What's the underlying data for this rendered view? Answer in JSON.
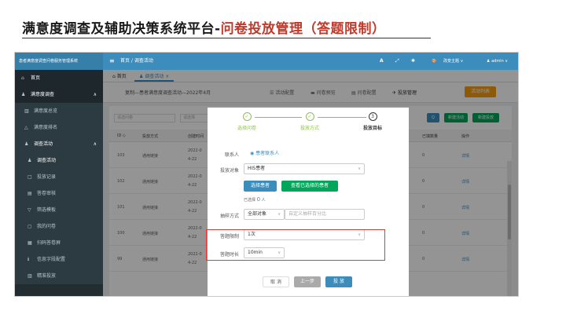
{
  "slide": {
    "title_main": "满意度调查及辅助决策系统平台-",
    "title_highlight": "问卷投放管理（答题限制）"
  },
  "topbar": {
    "brand": "患者满意度调查问卷服务管理系统",
    "menu_icon": "≡",
    "breadcrumb": "首页 / 调查活动",
    "icons": [
      "A",
      "⤢",
      "✱",
      "🎨"
    ],
    "theme_label": "改变主题 ∨",
    "user_label": "admin ∨"
  },
  "sidebar": {
    "items": [
      {
        "icon": "home-icon",
        "glyph": "⌂",
        "label": "首页",
        "level": 0
      },
      {
        "icon": "users-icon",
        "glyph": "♟",
        "label": "满意度调查",
        "level": 0,
        "caret": "∧"
      },
      {
        "icon": "chart-icon",
        "glyph": "▥",
        "label": "满意度总览",
        "level": 1
      },
      {
        "icon": "trend-icon",
        "glyph": "△",
        "label": "满意度排名",
        "level": 1
      },
      {
        "icon": "users-icon",
        "glyph": "♟",
        "label": "调查活动",
        "level": 1,
        "caret": "∧"
      },
      {
        "icon": "users-icon",
        "glyph": "♟",
        "label": "调查活动",
        "level": 2,
        "active": true
      },
      {
        "icon": "record-icon",
        "glyph": "□",
        "label": "投放记录",
        "level": 2
      },
      {
        "icon": "print-icon",
        "glyph": "▤",
        "label": "答卷审核",
        "level": 2
      },
      {
        "icon": "filter-icon",
        "glyph": "▽",
        "label": "筛选模板",
        "level": 2
      },
      {
        "icon": "doc-icon",
        "glyph": "▢",
        "label": "我的问卷",
        "level": 2
      },
      {
        "icon": "grid-icon",
        "glyph": "▦",
        "label": "扫码答卷屏",
        "level": 2
      },
      {
        "icon": "info-icon",
        "glyph": "ℹ",
        "label": "信息字段配置",
        "level": 2
      },
      {
        "icon": "chart-icon",
        "glyph": "▥",
        "label": "精准投放",
        "level": 2
      }
    ]
  },
  "tabs": [
    {
      "label": "首页",
      "active": false
    },
    {
      "label": "调查活动 ×",
      "active": true
    }
  ],
  "steprow": {
    "title": "复制—患者满意度调查活动—2022年4月",
    "steps": [
      "活动配置",
      "问卷预览",
      "问卷配置",
      "投放管理"
    ],
    "action_button": "活动列表"
  },
  "bg_table": {
    "filters": [
      "请选问卷",
      "请选择"
    ],
    "buttons": [
      "Q",
      "新建活动",
      "新建投放"
    ],
    "headers": [
      "ID ◇",
      "投放方式",
      "创建时间",
      "已填数量",
      "操作"
    ],
    "rows": [
      {
        "id": "103",
        "method": "通用链接",
        "date_a": "2022-0",
        "date_b": "4-22",
        "count": "0",
        "op": "详情"
      },
      {
        "id": "102",
        "method": "通用链接",
        "date_a": "2022-0",
        "date_b": "4-22",
        "count": "0",
        "op": "详情"
      },
      {
        "id": "101",
        "method": "通用链接",
        "date_a": "2022-0",
        "date_b": "4-22",
        "count": "0",
        "op": "详情"
      },
      {
        "id": "100",
        "method": "通用链接",
        "date_a": "2022-0",
        "date_b": "4-22",
        "count": "0",
        "op": "详情"
      },
      {
        "id": "99",
        "method": "通用链接",
        "date_a": "2022-0",
        "date_b": "4-22",
        "count": "0",
        "op": "详情"
      }
    ]
  },
  "modal": {
    "steps": [
      {
        "num": "✓",
        "label": "选择问卷"
      },
      {
        "num": "✓",
        "label": "投放方式"
      },
      {
        "num": "3",
        "label": "投放目标"
      }
    ],
    "contact_label": "联系人",
    "contact_option": "患者联系人",
    "target_label": "投放对象",
    "target_value": "HIS患者",
    "select_patient_btn": "选择患者",
    "view_selected_btn": "查看已选择的患者",
    "selected_text": "已选择",
    "selected_count": "0",
    "selected_unit": "人",
    "sample_label": "抽样方式",
    "sample_value": "全部对象",
    "sample_placeholder": "自定义抽样百分比",
    "answer_limit_label": "答题限制",
    "answer_limit_value": "1次",
    "answer_time_label": "答题时长",
    "answer_time_value": "10min",
    "cancel_btn": "取 消",
    "prev_btn": "上一步",
    "submit_btn": "投 放"
  },
  "colors": {
    "primary": "#3c8dbc",
    "sidebar": "#222d32",
    "success": "#00a65a",
    "warning": "#f39c12",
    "highlight_box": "#e53935"
  }
}
